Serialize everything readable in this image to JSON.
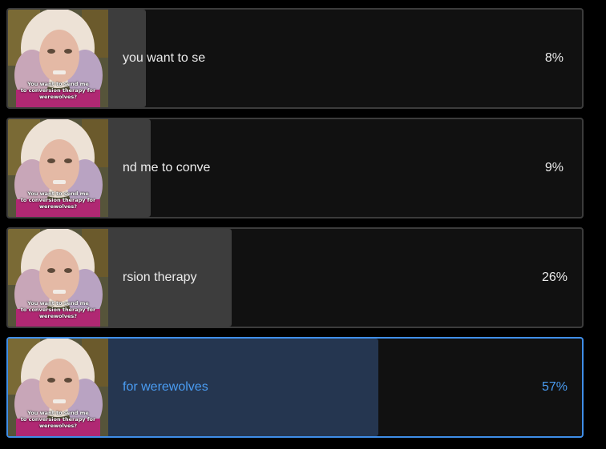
{
  "poll": {
    "options": [
      {
        "label": "you want to se",
        "percent_text": "8%",
        "percent": 8,
        "selected": false
      },
      {
        "label": "nd me to conve",
        "percent_text": "9%",
        "percent": 9,
        "selected": false
      },
      {
        "label": "rsion therapy",
        "percent_text": "26%",
        "percent": 26,
        "selected": false
      },
      {
        "label": "for werewolves",
        "percent_text": "57%",
        "percent": 57,
        "selected": true
      }
    ],
    "thumbnail_caption_line1": "You want to send me",
    "thumbnail_caption_line2": "to conversion therapy for werewolves?"
  },
  "colors": {
    "background": "#000000",
    "option_bg": "#111111",
    "fill": "#3d3d3d",
    "selected_fill": "#253650",
    "selected_accent": "#4a9cf2",
    "border": "#3c3c3c",
    "selected_border": "#3f8ee8"
  }
}
